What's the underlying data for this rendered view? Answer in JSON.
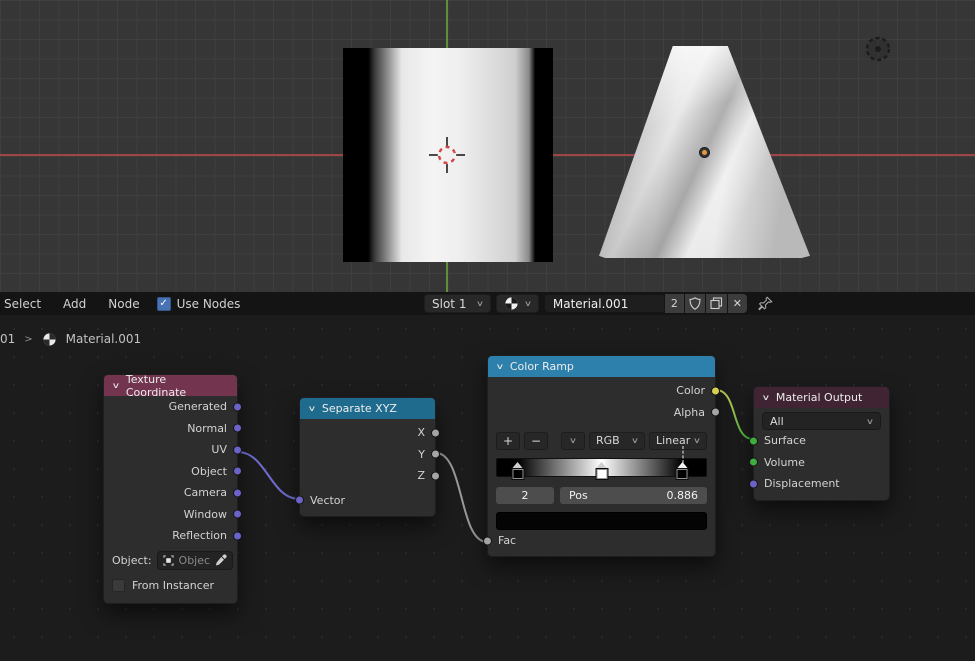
{
  "header": {
    "menus": [
      "Select",
      "Add",
      "Node"
    ],
    "use_nodes": {
      "label": "Use Nodes",
      "checked": true
    },
    "slot": {
      "value": "Slot 1"
    },
    "material_name": {
      "value": "Material.001"
    },
    "users_count": "2"
  },
  "breadcrumb": {
    "parent": "01",
    "separator": ">",
    "name": "Material.001"
  },
  "nodes": {
    "texture_coordinate": {
      "title": "Texture Coordinate",
      "outputs": [
        "Generated",
        "Normal",
        "UV",
        "Object",
        "Camera",
        "Window",
        "Reflection"
      ],
      "object_label": "Object:",
      "object_value": "Objec",
      "from_instancer": {
        "label": "From Instancer",
        "checked": false
      }
    },
    "separate_xyz": {
      "title": "Separate XYZ",
      "outputs": [
        "X",
        "Y",
        "Z"
      ],
      "input": "Vector"
    },
    "color_ramp": {
      "title": "Color Ramp",
      "outputs": [
        "Color",
        "Alpha"
      ],
      "add_label": "+",
      "remove_label": "−",
      "color_mode": "RGB",
      "interpolation": "Linear",
      "active_index": "2",
      "pos_label": "Pos",
      "pos_value": "0.886",
      "input": "Fac",
      "stops": [
        {
          "pos": "10%",
          "color": "#000000",
          "selected": false
        },
        {
          "pos": "50%",
          "color": "#ffffff",
          "selected": false
        },
        {
          "pos": "88.6%",
          "color": "#000000",
          "selected": true
        }
      ],
      "active_color": "#000000"
    },
    "material_output": {
      "title": "Material Output",
      "target": "All",
      "inputs": [
        "Surface",
        "Volume",
        "Displacement"
      ]
    }
  },
  "icons": {
    "chevron_down": "∨",
    "check": "✓",
    "close": "✕",
    "breadcrumb_sep": ">"
  },
  "colors": {
    "accent_blue": "#4772b3",
    "header_input_node": "#72344e",
    "header_color_ramp_node": "#2e80ac",
    "header_separate_node": "#1f6b8e",
    "header_output_node": "#412434",
    "socket_vector": "#6c63c9",
    "socket_value": "#a5a5a5",
    "socket_color": "#d6cf53",
    "socket_shader": "#3fae3f",
    "axis_x": "#b24848",
    "axis_y": "#6a9c3c",
    "origin_dot": "#e8983f"
  }
}
